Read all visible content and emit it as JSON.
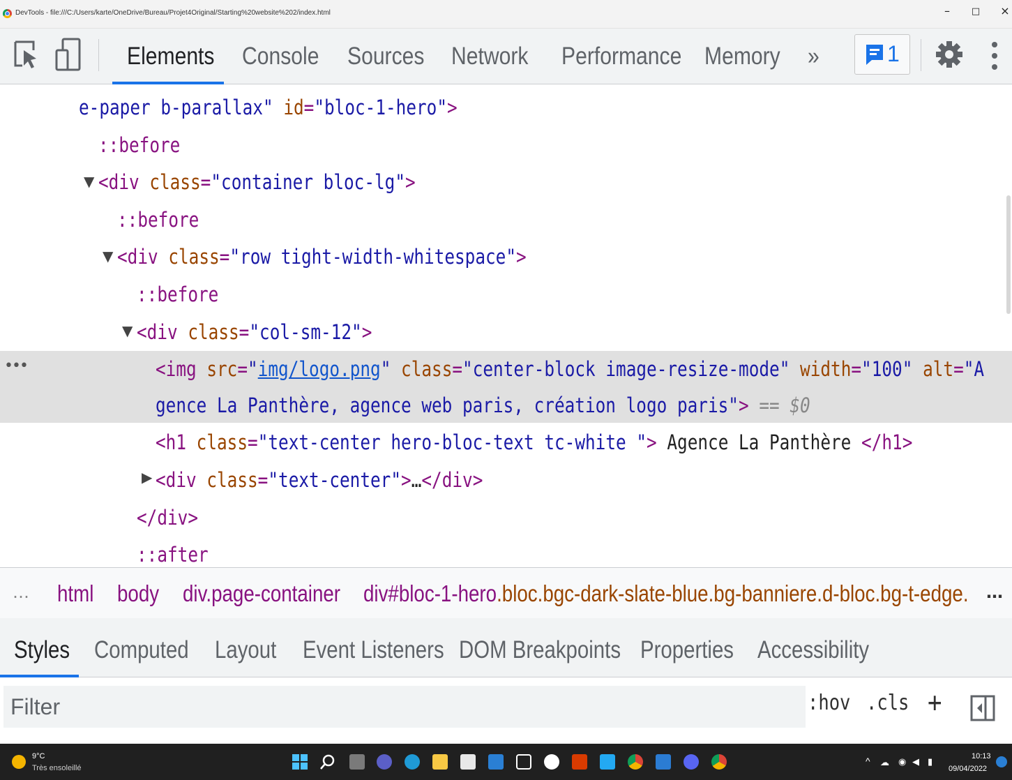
{
  "window": {
    "title": "DevTools - file:///C:/Users/karte/OneDrive/Bureau/Projet4Original/Starting%20website%202/index.html",
    "minimize": "–",
    "maximize": "□",
    "close": "×"
  },
  "toolbar": {
    "tabs": [
      "Elements",
      "Console",
      "Sources",
      "Network",
      "Performance",
      "Memory"
    ],
    "active_tab": "Elements",
    "more": "»",
    "issues_count": "1",
    "accent": "#1a73e8"
  },
  "dom": {
    "l1_cont": "e-paper b-parallax\"",
    "l1_attr": "id",
    "l1_val": "\"bloc-1-hero\"",
    "before": "::before",
    "after": "::after",
    "l3_tag": "<div",
    "class": "class",
    "l3_val": "\"container bloc-lg\"",
    "l5_val": "\"row tight-width-whitespace\"",
    "l7_val": "\"col-sm-12\"",
    "img_tag": "<img",
    "src": "src",
    "src_q": "\"",
    "src_val": "img/logo.png",
    "img_class_val": "\"center-block image-resize-mode\"",
    "width": "width",
    "width_val": "\"100\"",
    "alt": "alt",
    "alt_val1": "\"A",
    "alt_val2": "gence La Panthère, agence web paris, création logo paris\"",
    "close_gt": ">",
    "eq0": "== $0",
    "h1_open": "<h1",
    "h1_class_val": "\"text-center hero-bloc-text tc-white \"",
    "h1_text": "Agence La Panthère",
    "h1_close": "</h1>",
    "div2_val": "\"text-center\"",
    "ellipsis": "…",
    "div_close": "</div>",
    "more_dots": "•••"
  },
  "breadcrumbs": {
    "lead": "…",
    "items": [
      "html",
      "body",
      "div.page-container"
    ],
    "last_id": "div#bloc-1-hero",
    "last_cls": ".bloc.bgc-dark-slate-blue.bg-banniere.d-bloc.bg-t-edge.",
    "trail": "…"
  },
  "panel_tabs": {
    "items": [
      "Styles",
      "Computed",
      "Layout",
      "Event Listeners",
      "DOM Breakpoints",
      "Properties",
      "Accessibility"
    ],
    "active": "Styles"
  },
  "filter": {
    "placeholder": "Filter",
    "hov": ":hov",
    "cls": ".cls",
    "plus": "+"
  },
  "taskbar": {
    "weather_temp": "9°C",
    "weather_desc": "Très ensoleillé",
    "time": "10:13",
    "date": "09/04/2022"
  }
}
